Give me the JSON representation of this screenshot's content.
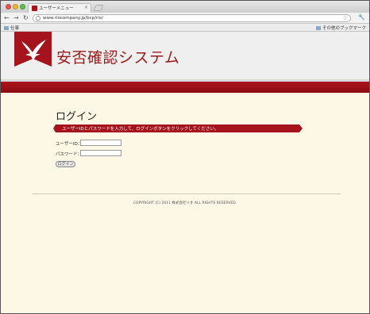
{
  "browser": {
    "tab_title": "ユーザーメニュー",
    "url": "www.riocompany.jp/bcp/rio/",
    "bookmark_left": "仕事",
    "bookmark_right": "その他のブックマーク"
  },
  "header": {
    "site_title": "安否確認システム",
    "brand_color": "#a5131c"
  },
  "login": {
    "title": "ログイン",
    "instruction": "ユーザーIDとパスワードを入力して、ログインボタンをクリックしてください。",
    "user_label": "ユーザーID：",
    "password_label": "パスワード：",
    "user_value": "",
    "password_value": "",
    "button_label": "ログイン"
  },
  "footer": {
    "copyright": "COPYRIGHT (C) 2011 株式会社リオ ALL RIGHTS RESERVED."
  }
}
